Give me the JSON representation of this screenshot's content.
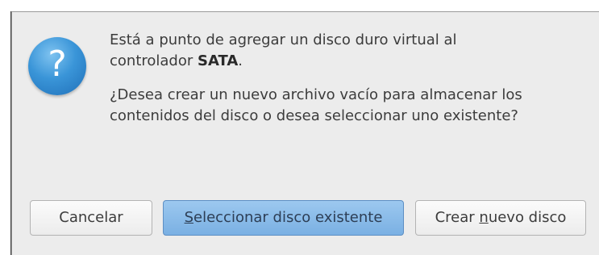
{
  "message": {
    "line1_pre": "Está a punto de agregar un disco duro virtual al",
    "line2_pre": "controlador ",
    "controller": "SATA",
    "line2_post": ".",
    "question": "¿Desea crear un nuevo archivo vacío para almacenar los contenidos del disco o desea seleccionar uno existente?"
  },
  "buttons": {
    "cancel_label": "Cancelar",
    "select_mnemonic": "S",
    "select_rest": "eleccionar disco existente",
    "create_pre": "Crear ",
    "create_mnemonic": "n",
    "create_rest": "uevo disco"
  },
  "icons": {
    "dialog_icon": "question-icon",
    "dialog_icon_glyph": "?"
  },
  "colors": {
    "accent": "#7ab0e3",
    "icon_blue": "#3a95d8",
    "dialog_bg": "#ececec"
  }
}
